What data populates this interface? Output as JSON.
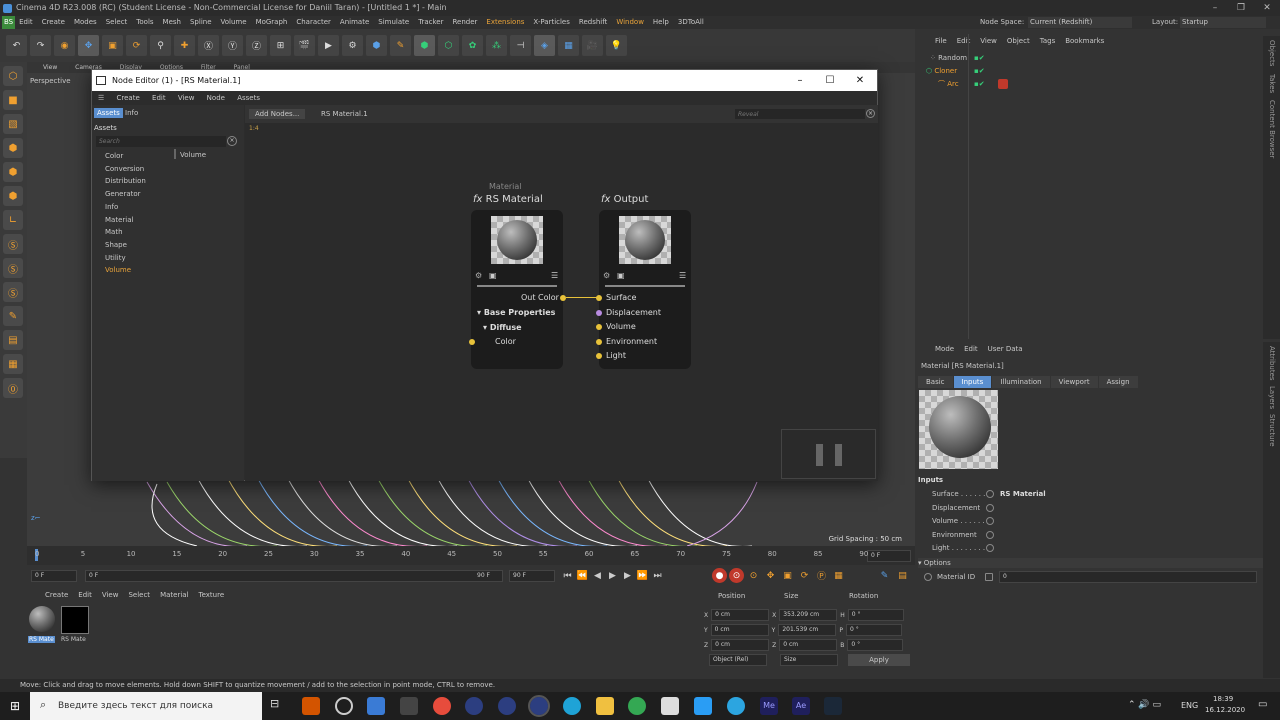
{
  "app": {
    "title": "Cinema 4D R23.008 (RC) (Student License - Non-Commercial License for Daniil Taran) - [Untitled 1 *] - Main"
  },
  "menu": [
    "Edit",
    "Create",
    "Modes",
    "Select",
    "Tools",
    "Mesh",
    "Spline",
    "Volume",
    "MoGraph",
    "Character",
    "Animate",
    "Simulate",
    "Tracker",
    "Render",
    "Extensions",
    "X-Particles",
    "Redshift",
    "Window",
    "Help",
    "3DToAll"
  ],
  "node_space_label": "Node Space:",
  "node_space_value": "Current (Redshift)",
  "layout_label": "Layout:",
  "layout_value": "Startup",
  "viewport": {
    "menu": [
      "View",
      "Cameras",
      "Display",
      "Options",
      "Filter",
      "Panel"
    ],
    "name": "Perspective",
    "grid_spacing": "Grid Spacing : 50 cm"
  },
  "timeline": {
    "ticks": [
      "0",
      "5",
      "10",
      "15",
      "20",
      "25",
      "30",
      "35",
      "40",
      "45",
      "50",
      "55",
      "60",
      "65",
      "70",
      "75",
      "80",
      "85",
      "90"
    ],
    "frame_end_field": "0 F",
    "cur_frame": "0 F",
    "start_frame": "0 F",
    "end_frame": "90 F",
    "end_frame2": "90 F"
  },
  "material_manager": {
    "menu": [
      "Create",
      "Edit",
      "View",
      "Select",
      "Material",
      "Texture"
    ],
    "materials": [
      "RS Mate",
      "RS Mate"
    ]
  },
  "coordinates": {
    "headers": [
      "Position",
      "Size",
      "Rotation"
    ],
    "rows": [
      {
        "a": "X",
        "pos": "0 cm",
        "s": "X",
        "size": "353.209 cm",
        "r": "H",
        "rot": "0 °"
      },
      {
        "a": "Y",
        "pos": "0 cm",
        "s": "Y",
        "size": "201.539 cm",
        "r": "P",
        "rot": "0 °"
      },
      {
        "a": "Z",
        "pos": "0 cm",
        "s": "Z",
        "size": "0 cm",
        "r": "B",
        "rot": "0 °"
      }
    ],
    "mode": "Object (Rel)",
    "size_mode": "Size",
    "apply": "Apply"
  },
  "status": "Move: Click and drag to move elements. Hold down SHIFT to quantize movement / add to the selection in point mode, CTRL to remove.",
  "object_manager": {
    "menu": [
      "File",
      "Edit",
      "View",
      "Object",
      "Tags",
      "Bookmarks"
    ],
    "objects": [
      "Random",
      "Cloner",
      "Arc"
    ]
  },
  "attributes": {
    "menu": [
      "Mode",
      "Edit",
      "User Data"
    ],
    "header": "Material [RS Material.1]",
    "tabs": [
      "Basic",
      "Inputs",
      "Illumination",
      "Viewport",
      "Assign"
    ],
    "section": "Inputs",
    "inputs": [
      {
        "label": "Surface . . . . . .",
        "value": "RS Material"
      },
      {
        "label": "Displacement",
        "value": ""
      },
      {
        "label": "Volume . . . . . .",
        "value": ""
      },
      {
        "label": "Environment",
        "value": ""
      },
      {
        "label": "Light . . . . . . . .",
        "value": ""
      }
    ],
    "options_title": "Options",
    "material_id_label": "Material ID",
    "material_id_value": "0"
  },
  "node_editor": {
    "title": "Node Editor (1) - [RS Material.1]",
    "menu": [
      "Create",
      "Edit",
      "View",
      "Node",
      "Assets"
    ],
    "tabs": [
      "Assets",
      "Info"
    ],
    "assets_label": "Assets",
    "search_placeholder": "Search",
    "categories": [
      "Color",
      "Conversion",
      "Distribution",
      "Generator",
      "Info",
      "Material",
      "Math",
      "Shape",
      "Utility",
      "Volume"
    ],
    "subcategory": "Volume",
    "add_nodes": "Add Nodes...",
    "breadcrumb": "RS Material.1",
    "reveal_placeholder": "Reveal",
    "zoom": "1:4",
    "material_group_label": "Material",
    "node_rs": {
      "title": "RS Material",
      "out": "Out Color",
      "group": "Base Properties",
      "sub": "Diffuse",
      "port": "Color"
    },
    "node_out": {
      "title": "Output",
      "ports": [
        "Surface",
        "Displacement",
        "Volume",
        "Environment",
        "Light"
      ]
    }
  },
  "taskbar": {
    "search": "Введите здесь текст для поиска",
    "lang": "ENG",
    "time": "18:39",
    "date": "16.12.2020"
  },
  "side_tabs_top": [
    "Objects",
    "Takes",
    "Content Browser"
  ],
  "side_tabs_bottom": [
    "Attributes",
    "Layers",
    "Structure"
  ]
}
